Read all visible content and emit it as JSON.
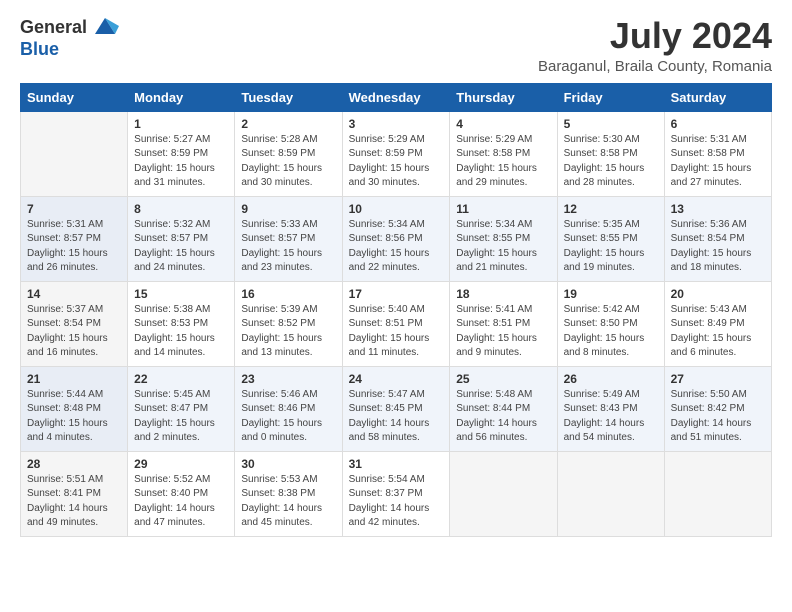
{
  "logo": {
    "general": "General",
    "blue": "Blue"
  },
  "title": "July 2024",
  "location": "Baraganul, Braila County, Romania",
  "weekdays": [
    "Sunday",
    "Monday",
    "Tuesday",
    "Wednesday",
    "Thursday",
    "Friday",
    "Saturday"
  ],
  "weeks": [
    [
      {
        "day": "",
        "info": ""
      },
      {
        "day": "1",
        "info": "Sunrise: 5:27 AM\nSunset: 8:59 PM\nDaylight: 15 hours\nand 31 minutes."
      },
      {
        "day": "2",
        "info": "Sunrise: 5:28 AM\nSunset: 8:59 PM\nDaylight: 15 hours\nand 30 minutes."
      },
      {
        "day": "3",
        "info": "Sunrise: 5:29 AM\nSunset: 8:59 PM\nDaylight: 15 hours\nand 30 minutes."
      },
      {
        "day": "4",
        "info": "Sunrise: 5:29 AM\nSunset: 8:58 PM\nDaylight: 15 hours\nand 29 minutes."
      },
      {
        "day": "5",
        "info": "Sunrise: 5:30 AM\nSunset: 8:58 PM\nDaylight: 15 hours\nand 28 minutes."
      },
      {
        "day": "6",
        "info": "Sunrise: 5:31 AM\nSunset: 8:58 PM\nDaylight: 15 hours\nand 27 minutes."
      }
    ],
    [
      {
        "day": "7",
        "info": "Sunrise: 5:31 AM\nSunset: 8:57 PM\nDaylight: 15 hours\nand 26 minutes."
      },
      {
        "day": "8",
        "info": "Sunrise: 5:32 AM\nSunset: 8:57 PM\nDaylight: 15 hours\nand 24 minutes."
      },
      {
        "day": "9",
        "info": "Sunrise: 5:33 AM\nSunset: 8:57 PM\nDaylight: 15 hours\nand 23 minutes."
      },
      {
        "day": "10",
        "info": "Sunrise: 5:34 AM\nSunset: 8:56 PM\nDaylight: 15 hours\nand 22 minutes."
      },
      {
        "day": "11",
        "info": "Sunrise: 5:34 AM\nSunset: 8:55 PM\nDaylight: 15 hours\nand 21 minutes."
      },
      {
        "day": "12",
        "info": "Sunrise: 5:35 AM\nSunset: 8:55 PM\nDaylight: 15 hours\nand 19 minutes."
      },
      {
        "day": "13",
        "info": "Sunrise: 5:36 AM\nSunset: 8:54 PM\nDaylight: 15 hours\nand 18 minutes."
      }
    ],
    [
      {
        "day": "14",
        "info": "Sunrise: 5:37 AM\nSunset: 8:54 PM\nDaylight: 15 hours\nand 16 minutes."
      },
      {
        "day": "15",
        "info": "Sunrise: 5:38 AM\nSunset: 8:53 PM\nDaylight: 15 hours\nand 14 minutes."
      },
      {
        "day": "16",
        "info": "Sunrise: 5:39 AM\nSunset: 8:52 PM\nDaylight: 15 hours\nand 13 minutes."
      },
      {
        "day": "17",
        "info": "Sunrise: 5:40 AM\nSunset: 8:51 PM\nDaylight: 15 hours\nand 11 minutes."
      },
      {
        "day": "18",
        "info": "Sunrise: 5:41 AM\nSunset: 8:51 PM\nDaylight: 15 hours\nand 9 minutes."
      },
      {
        "day": "19",
        "info": "Sunrise: 5:42 AM\nSunset: 8:50 PM\nDaylight: 15 hours\nand 8 minutes."
      },
      {
        "day": "20",
        "info": "Sunrise: 5:43 AM\nSunset: 8:49 PM\nDaylight: 15 hours\nand 6 minutes."
      }
    ],
    [
      {
        "day": "21",
        "info": "Sunrise: 5:44 AM\nSunset: 8:48 PM\nDaylight: 15 hours\nand 4 minutes."
      },
      {
        "day": "22",
        "info": "Sunrise: 5:45 AM\nSunset: 8:47 PM\nDaylight: 15 hours\nand 2 minutes."
      },
      {
        "day": "23",
        "info": "Sunrise: 5:46 AM\nSunset: 8:46 PM\nDaylight: 15 hours\nand 0 minutes."
      },
      {
        "day": "24",
        "info": "Sunrise: 5:47 AM\nSunset: 8:45 PM\nDaylight: 14 hours\nand 58 minutes."
      },
      {
        "day": "25",
        "info": "Sunrise: 5:48 AM\nSunset: 8:44 PM\nDaylight: 14 hours\nand 56 minutes."
      },
      {
        "day": "26",
        "info": "Sunrise: 5:49 AM\nSunset: 8:43 PM\nDaylight: 14 hours\nand 54 minutes."
      },
      {
        "day": "27",
        "info": "Sunrise: 5:50 AM\nSunset: 8:42 PM\nDaylight: 14 hours\nand 51 minutes."
      }
    ],
    [
      {
        "day": "28",
        "info": "Sunrise: 5:51 AM\nSunset: 8:41 PM\nDaylight: 14 hours\nand 49 minutes."
      },
      {
        "day": "29",
        "info": "Sunrise: 5:52 AM\nSunset: 8:40 PM\nDaylight: 14 hours\nand 47 minutes."
      },
      {
        "day": "30",
        "info": "Sunrise: 5:53 AM\nSunset: 8:38 PM\nDaylight: 14 hours\nand 45 minutes."
      },
      {
        "day": "31",
        "info": "Sunrise: 5:54 AM\nSunset: 8:37 PM\nDaylight: 14 hours\nand 42 minutes."
      },
      {
        "day": "",
        "info": ""
      },
      {
        "day": "",
        "info": ""
      },
      {
        "day": "",
        "info": ""
      }
    ]
  ]
}
